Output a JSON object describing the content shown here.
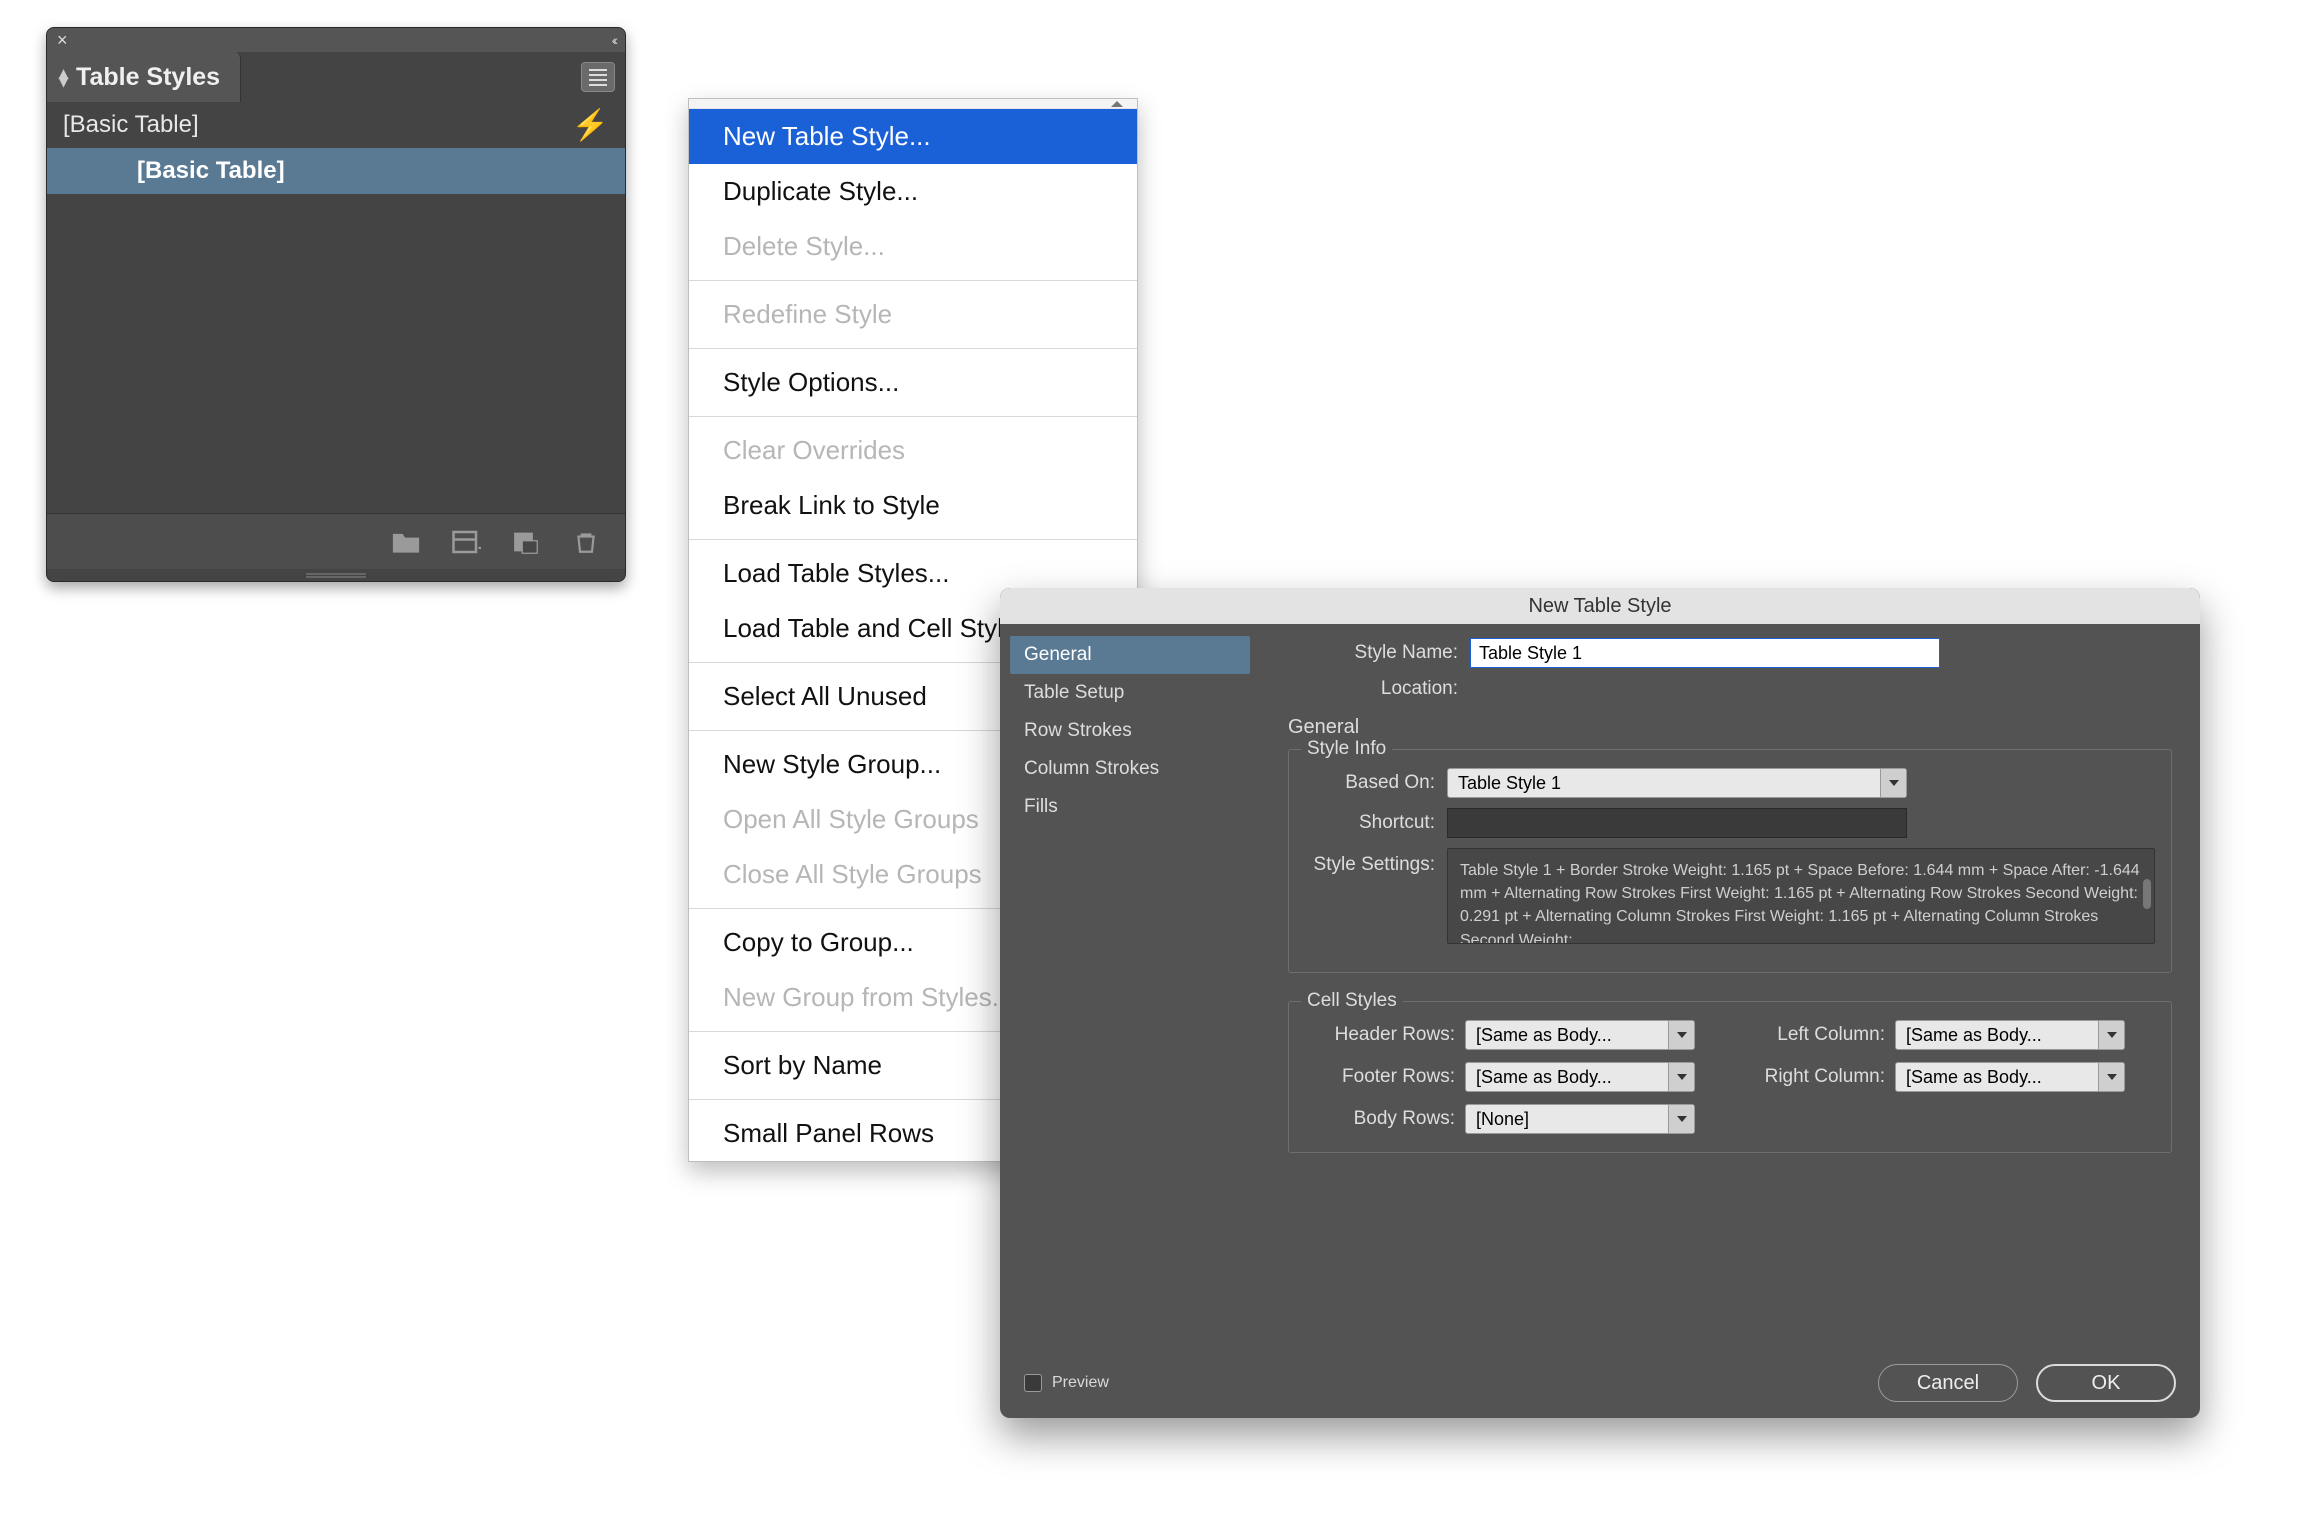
{
  "panel": {
    "title": "Table Styles",
    "styles": [
      {
        "name": "[Basic Table]",
        "selected": false
      },
      {
        "name": "[Basic Table]",
        "selected": true
      }
    ],
    "footer_icons": [
      "folder-icon",
      "new-style-icon",
      "clear-override-icon",
      "trash-icon"
    ]
  },
  "flyout": {
    "groups": [
      [
        {
          "label": "New Table Style...",
          "state": "highlight"
        },
        {
          "label": "Duplicate Style...",
          "state": "normal"
        },
        {
          "label": "Delete Style...",
          "state": "disabled"
        }
      ],
      [
        {
          "label": "Redefine Style",
          "state": "disabled"
        }
      ],
      [
        {
          "label": "Style Options...",
          "state": "normal"
        }
      ],
      [
        {
          "label": "Clear Overrides",
          "state": "disabled"
        },
        {
          "label": "Break Link to Style",
          "state": "normal"
        }
      ],
      [
        {
          "label": "Load Table Styles...",
          "state": "normal"
        },
        {
          "label": "Load Table and Cell Styles...",
          "state": "normal"
        }
      ],
      [
        {
          "label": "Select All Unused",
          "state": "normal"
        }
      ],
      [
        {
          "label": "New Style Group...",
          "state": "normal"
        },
        {
          "label": "Open All Style Groups",
          "state": "disabled"
        },
        {
          "label": "Close All Style Groups",
          "state": "disabled"
        }
      ],
      [
        {
          "label": "Copy to Group...",
          "state": "normal"
        },
        {
          "label": "New Group from Styles...",
          "state": "disabled"
        }
      ],
      [
        {
          "label": "Sort by Name",
          "state": "normal"
        }
      ],
      [
        {
          "label": "Small Panel Rows",
          "state": "normal"
        }
      ]
    ]
  },
  "dialog": {
    "title": "New Table Style",
    "sidebar": [
      "General",
      "Table Setup",
      "Row Strokes",
      "Column Strokes",
      "Fills"
    ],
    "sidebar_active": "General",
    "style_name_label": "Style Name:",
    "style_name_value": "Table Style 1",
    "location_label": "Location:",
    "location_value": "",
    "section_general": "General",
    "style_info": {
      "legend": "Style Info",
      "based_on_label": "Based On:",
      "based_on_value": "Table Style 1",
      "shortcut_label": "Shortcut:",
      "shortcut_value": "",
      "settings_label": "Style Settings:",
      "settings_text": "Table Style 1 + Border Stroke Weight: 1.165 pt + Space Before: 1.644 mm + Space After: -1.644 mm + Alternating Row Strokes First Weight: 1.165 pt + Alternating Row Strokes Second Weight: 0.291 pt + Alternating Column Strokes First Weight: 1.165 pt + Alternating Column Strokes Second Weight:"
    },
    "cell_styles": {
      "legend": "Cell Styles",
      "header_rows_label": "Header Rows:",
      "header_rows_value": "[Same as Body...",
      "footer_rows_label": "Footer Rows:",
      "footer_rows_value": "[Same as Body...",
      "body_rows_label": "Body Rows:",
      "body_rows_value": "[None]",
      "left_column_label": "Left Column:",
      "left_column_value": "[Same as Body...",
      "right_column_label": "Right Column:",
      "right_column_value": "[Same as Body..."
    },
    "preview_label": "Preview",
    "cancel_label": "Cancel",
    "ok_label": "OK"
  }
}
